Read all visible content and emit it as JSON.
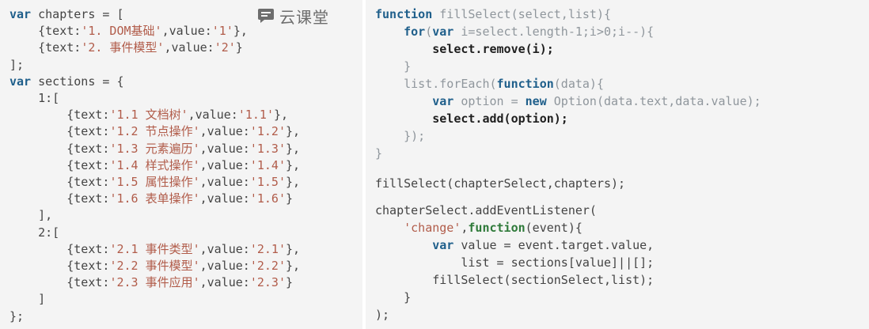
{
  "watermark": {
    "brand_text": "云课堂",
    "icon": "chat-bubble-icon"
  },
  "colors": {
    "keyword": "#1f5f8b",
    "string": "#b15c4a",
    "default": "#444444",
    "light": "#8f969c",
    "bold": "#1e1e1e",
    "function_keyword": "#2f7a3a",
    "panel_background": "#f4f4f4"
  },
  "left_code": [
    [
      [
        "kw",
        "var"
      ],
      [
        "def",
        " chapters = ["
      ]
    ],
    [
      [
        "def",
        "    {text:"
      ],
      [
        "str",
        "'1. DOM基础'"
      ],
      [
        "def",
        ",value:"
      ],
      [
        "str",
        "'1'"
      ],
      [
        "def",
        "},"
      ]
    ],
    [
      [
        "def",
        "    {text:"
      ],
      [
        "str",
        "'2. 事件模型'"
      ],
      [
        "def",
        ",value:"
      ],
      [
        "str",
        "'2'"
      ],
      [
        "def",
        "}"
      ]
    ],
    [
      [
        "def",
        "];"
      ]
    ],
    [
      [
        "kw",
        "var"
      ],
      [
        "def",
        " sections = {"
      ]
    ],
    [
      [
        "def",
        "    1:["
      ]
    ],
    [
      [
        "def",
        "        {text:"
      ],
      [
        "str",
        "'1.1 文档树'"
      ],
      [
        "def",
        ",value:"
      ],
      [
        "str",
        "'1.1'"
      ],
      [
        "def",
        "},"
      ]
    ],
    [
      [
        "def",
        "        {text:"
      ],
      [
        "str",
        "'1.2 节点操作'"
      ],
      [
        "def",
        ",value:"
      ],
      [
        "str",
        "'1.2'"
      ],
      [
        "def",
        "},"
      ]
    ],
    [
      [
        "def",
        "        {text:"
      ],
      [
        "str",
        "'1.3 元素遍历'"
      ],
      [
        "def",
        ",value:"
      ],
      [
        "str",
        "'1.3'"
      ],
      [
        "def",
        "},"
      ]
    ],
    [
      [
        "def",
        "        {text:"
      ],
      [
        "str",
        "'1.4 样式操作'"
      ],
      [
        "def",
        ",value:"
      ],
      [
        "str",
        "'1.4'"
      ],
      [
        "def",
        "},"
      ]
    ],
    [
      [
        "def",
        "        {text:"
      ],
      [
        "str",
        "'1.5 属性操作'"
      ],
      [
        "def",
        ",value:"
      ],
      [
        "str",
        "'1.5'"
      ],
      [
        "def",
        "},"
      ]
    ],
    [
      [
        "def",
        "        {text:"
      ],
      [
        "str",
        "'1.6 表单操作'"
      ],
      [
        "def",
        ",value:"
      ],
      [
        "str",
        "'1.6'"
      ],
      [
        "def",
        "}"
      ]
    ],
    [
      [
        "def",
        "    ],"
      ]
    ],
    [
      [
        "def",
        "    2:["
      ]
    ],
    [
      [
        "def",
        "        {text:"
      ],
      [
        "str",
        "'2.1 事件类型'"
      ],
      [
        "def",
        ",value:"
      ],
      [
        "str",
        "'2.1'"
      ],
      [
        "def",
        "},"
      ]
    ],
    [
      [
        "def",
        "        {text:"
      ],
      [
        "str",
        "'2.2 事件模型'"
      ],
      [
        "def",
        ",value:"
      ],
      [
        "str",
        "'2.2'"
      ],
      [
        "def",
        "},"
      ]
    ],
    [
      [
        "def",
        "        {text:"
      ],
      [
        "str",
        "'2.3 事件应用'"
      ],
      [
        "def",
        ",value:"
      ],
      [
        "str",
        "'2.3'"
      ],
      [
        "def",
        "}"
      ]
    ],
    [
      [
        "def",
        "    ]"
      ]
    ],
    [
      [
        "def",
        "};"
      ]
    ]
  ],
  "right_code": [
    [
      [
        "kw",
        "function"
      ],
      [
        "light",
        " fillSelect(select,list){"
      ]
    ],
    [
      [
        "light",
        "    "
      ],
      [
        "kw",
        "for"
      ],
      [
        "light",
        "("
      ],
      [
        "kw",
        "var"
      ],
      [
        "light",
        " i=select.length-1;i>0;i--){"
      ]
    ],
    [
      [
        "bold",
        "        select.remove(i);"
      ]
    ],
    [
      [
        "light",
        "    }"
      ]
    ],
    [
      [
        "light",
        "    list.forEach("
      ],
      [
        "kw",
        "function"
      ],
      [
        "light",
        "(data){"
      ]
    ],
    [
      [
        "light",
        "        "
      ],
      [
        "kw",
        "var"
      ],
      [
        "light",
        " option = "
      ],
      [
        "kw",
        "new"
      ],
      [
        "light",
        " Option(data.text,data.value);"
      ]
    ],
    [
      [
        "bold",
        "        select.add(option);"
      ]
    ],
    [
      [
        "light",
        "    });"
      ]
    ],
    [
      [
        "light",
        "}"
      ]
    ],
    [
      [
        "def",
        "fillSelect(chapterSelect,chapters);"
      ]
    ],
    [
      [
        "def",
        "chapterSelect.addEventListener("
      ]
    ],
    [
      [
        "def",
        "    "
      ],
      [
        "str",
        "'change'"
      ],
      [
        "def",
        ","
      ],
      [
        "fn",
        "function"
      ],
      [
        "def",
        "(event){"
      ]
    ],
    [
      [
        "def",
        "        "
      ],
      [
        "kw",
        "var"
      ],
      [
        "def",
        " value = event.target.value,"
      ]
    ],
    [
      [
        "def",
        "            list = sections[value]||[];"
      ]
    ],
    [
      [
        "def",
        "        fillSelect(sectionSelect,list);"
      ]
    ],
    [
      [
        "def",
        "    }"
      ]
    ],
    [
      [
        "def",
        ");"
      ]
    ]
  ]
}
